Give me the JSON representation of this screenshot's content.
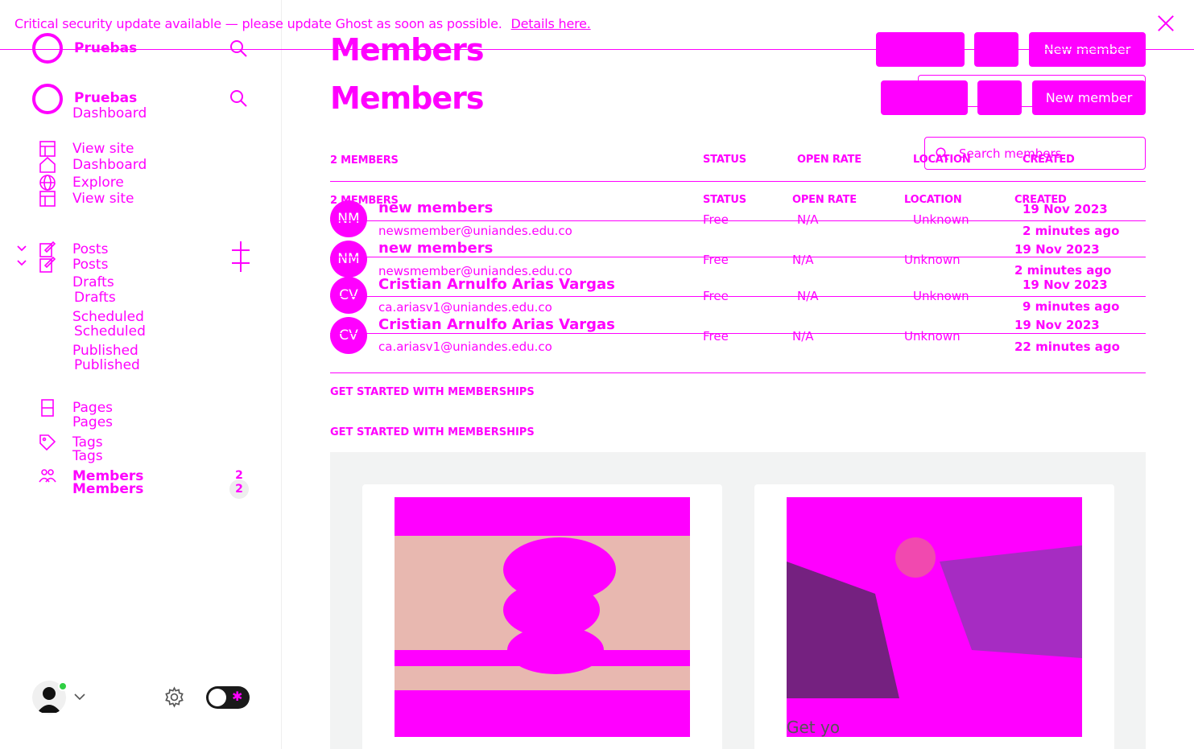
{
  "banner": {
    "text": "Critical security update available — please update Ghost as soon as possible.",
    "link": "Details here."
  },
  "sidebar": {
    "brand_name": "Pruebas",
    "nav": {
      "dashboard": "Dashboard",
      "view_site": "View site",
      "explore": "Explore",
      "posts": "Posts",
      "drafts": "Drafts",
      "scheduled": "Scheduled",
      "published": "Published",
      "pages": "Pages",
      "tags": "Tags",
      "members": "Members",
      "members_count": "2"
    }
  },
  "main": {
    "title": "Members",
    "new_member": "New member",
    "search_placeholder": "Search members",
    "columns": {
      "members_count": "2 MEMBERS",
      "status": "STATUS",
      "open_rate": "OPEN RATE",
      "location": "LOCATION",
      "created": "CREATED"
    },
    "rows": [
      {
        "initials": "NM",
        "name": "new members",
        "email": "newsmember@uniandes.edu.co",
        "status": "Free",
        "open_rate": "N/A",
        "location": "Unknown",
        "created": "19 Nov 2023",
        "ago": "2 minutes ago"
      },
      {
        "initials": "NM",
        "name": "new members",
        "email": "newsmember@uniandes.edu.co",
        "status": "Free",
        "open_rate": "N/A",
        "location": "Unknown",
        "created": "19 Nov 2023",
        "ago": "2 minutes ago"
      },
      {
        "initials": "CV",
        "name": "Cristian Arnulfo Arias Vargas",
        "email": "ca.ariasv1@uniandes.edu.co",
        "status": "Free",
        "open_rate": "N/A",
        "location": "Unknown",
        "created": "19 Nov 2023",
        "ago": "9 minutes ago"
      },
      {
        "initials": "CV",
        "name": "Cristian Arnulfo Arias Vargas",
        "email": "ca.ariasv1@uniandes.edu.co",
        "status": "Free",
        "open_rate": "N/A",
        "location": "Unknown",
        "created": "19 Nov 2023",
        "ago": "22 minutes ago"
      }
    ],
    "get_started": "GET STARTED WITH MEMBERSHIPS",
    "card_caption": "Get yo"
  },
  "colors": {
    "accent": "#ff00ff",
    "online": "#30cf43"
  }
}
